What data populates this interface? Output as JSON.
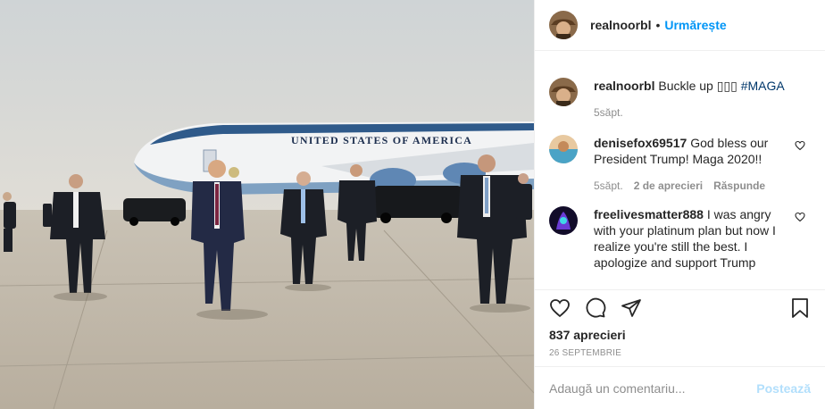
{
  "post_header": {
    "username": "realnoorbl",
    "separator": "•",
    "follow_label": "Urmărește"
  },
  "caption": {
    "username": "realnoorbl",
    "text": "Buckle up ▯▯▯",
    "hashtag": "#MAGA",
    "time": "5săpt."
  },
  "comments": [
    {
      "username": "denisefox69517",
      "text": "God bless our President Trump! Maga 2020!!",
      "time": "5săpt.",
      "likes": "2 de aprecieri",
      "reply_label": "Răspunde"
    },
    {
      "username": "freelivesmatter888",
      "text": "I was angry with your platinum plan but now I realize you're still the best. I apologize and support Trump"
    }
  ],
  "photo": {
    "plane_text": "UNITED STATES OF AMERICA"
  },
  "likes_count": "837 aprecieri",
  "post_date": "26 SEPTEMBRIE",
  "add_comment": {
    "placeholder": "Adaugă un comentariu...",
    "post_label": "Postează"
  },
  "colors": {
    "accent": "#0095f6",
    "post_disabled": "#b2dffc",
    "muted": "#8e8e8e",
    "heart": "#ed4956"
  },
  "icons": [
    "heart-icon",
    "comment-icon",
    "share-icon",
    "bookmark-icon"
  ]
}
